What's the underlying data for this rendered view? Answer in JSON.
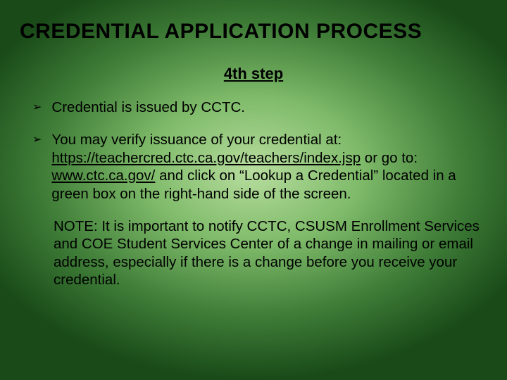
{
  "title": "CREDENTIAL APPLICATION PROCESS",
  "step_label": "4th step",
  "bullets": [
    {
      "text": "Credential is issued by CCTC."
    },
    {
      "pre": "You may verify issuance of your credential at: ",
      "link1": "https://teachercred.ctc.ca.gov/teachers/index.jsp",
      "mid": " or go to: ",
      "link2": "www.ctc.ca.gov/",
      "post": " and click on “Lookup a Credential” located in a green box on the right-hand side of the screen."
    }
  ],
  "note": "NOTE:  It is important to notify CCTC, CSUSM Enrollment Services and COE Student Services Center of a change in mailing or email address, especially if there is a change before you receive your credential."
}
